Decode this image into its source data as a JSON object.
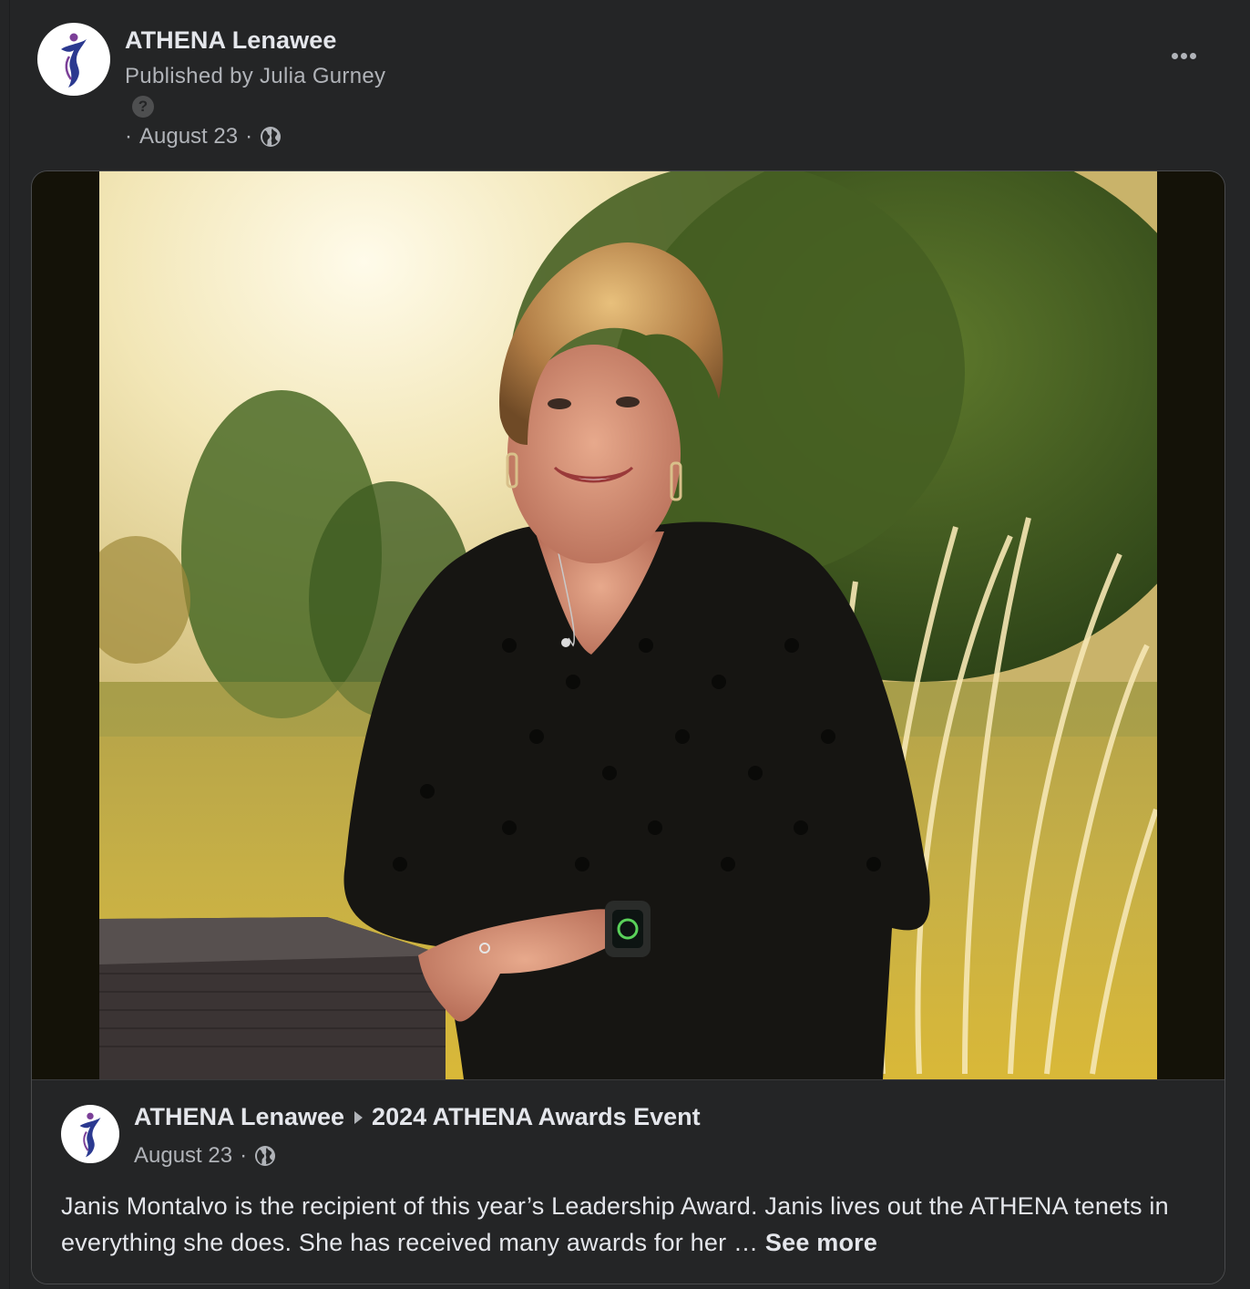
{
  "header": {
    "page_name": "ATHENA Lenawee",
    "publisher": "Published by Julia Gurney",
    "help_icon": "?",
    "separator": "·",
    "date": "August 23",
    "privacy_icon": "globe-icon",
    "more_icon": "more-options-icon"
  },
  "shared_post": {
    "photo_alt": "Portrait of Janis Montalvo in a black dotted blouse standing in front of sunlit ornamental grass",
    "page_name": "ATHENA Lenawee",
    "arrow_icon": "triangle-right-icon",
    "event_name": "2024 ATHENA Awards Event",
    "date": "August 23",
    "separator": "·",
    "caption_text": "Janis Montalvo is the recipient of this year’s Leadership Award. Janis lives out the ATHENA tenets in everything she does. She has received many awards for her …",
    "see_more": "See more"
  },
  "colors": {
    "background": "#242526",
    "primary_text": "#e4e6eb",
    "secondary_text": "#b0b3b8",
    "logo_blue": "#2b3990",
    "logo_purple": "#7b3f98"
  }
}
